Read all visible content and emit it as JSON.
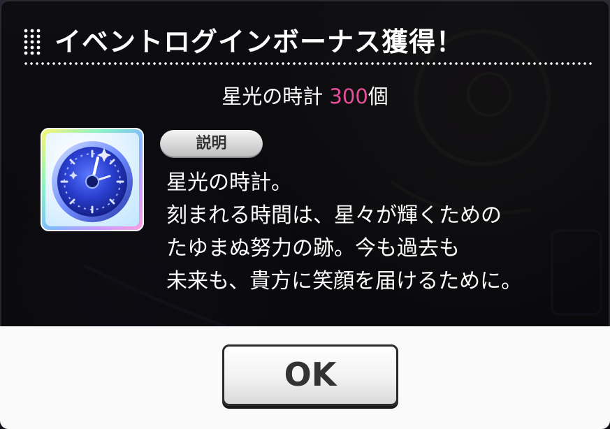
{
  "dialog": {
    "title": "イベントログインボーナス獲得！",
    "reward": {
      "item_name": "星光の時計",
      "count": "300",
      "unit": "個"
    },
    "item_icon": "clock-icon",
    "description_label": "説明",
    "description_lines": [
      "星光の時計。",
      "刻まれる時間は、星々が輝くための",
      "たゆまぬ努力の跡。今も過去も",
      "未来も、貴方に笑顔を届けるために。"
    ],
    "ok_label": "OK"
  },
  "colors": {
    "reward_count": "#e64d9a",
    "panel_background": "#08080a",
    "footer_background": "#fafafa"
  }
}
